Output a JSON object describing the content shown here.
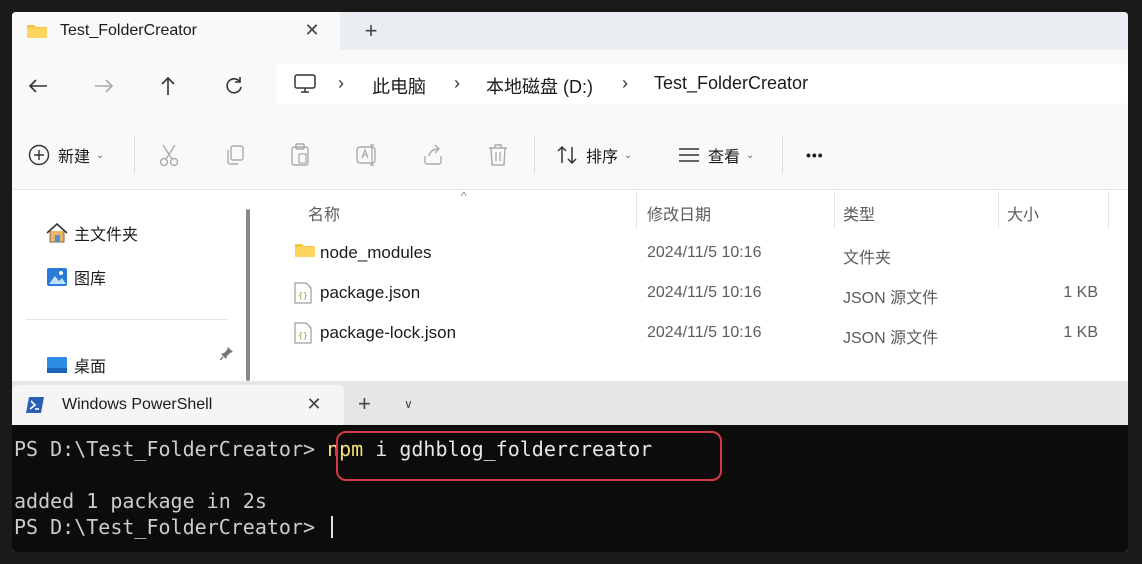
{
  "explorer": {
    "tab": {
      "title": "Test_FolderCreator",
      "close": "✕",
      "new_tab": "+"
    },
    "address": {
      "crumbs": [
        "此电脑",
        "本地磁盘 (D:)",
        "Test_FolderCreator"
      ],
      "separator": "›"
    },
    "toolbar": {
      "new_label": "新建",
      "sort_label": "排序",
      "view_label": "查看",
      "more": "•••",
      "caret": "⌄"
    },
    "nav": {
      "home": "主文件夹",
      "pictures": "图库",
      "desktop": "桌面"
    },
    "columns": {
      "name": "名称",
      "date": "修改日期",
      "type": "类型",
      "size": "大小",
      "sort_indicator": "^"
    },
    "files": [
      {
        "name": "node_modules",
        "date": "2024/11/5 10:16",
        "type": "文件夹",
        "size": "",
        "kind": "folder"
      },
      {
        "name": "package.json",
        "date": "2024/11/5 10:16",
        "type": "JSON 源文件",
        "size": "1 KB",
        "kind": "json"
      },
      {
        "name": "package-lock.json",
        "date": "2024/11/5 10:16",
        "type": "JSON 源文件",
        "size": "1 KB",
        "kind": "json"
      }
    ],
    "colors": {
      "folder": "#f4c542",
      "accent": "#0067c0"
    }
  },
  "terminal": {
    "tab": {
      "title": "Windows PowerShell",
      "close": "✕",
      "new_tab": "+",
      "dropdown": "∨"
    },
    "lines": {
      "prompt1": "PS D:\\Test_FolderCreator> ",
      "cmd_npm": "npm",
      "cmd_rest": " i gdhblog_foldercreator",
      "output": "added 1 package in 2s",
      "prompt2": "PS D:\\Test_FolderCreator> "
    },
    "colors": {
      "background": "#0c0c0c",
      "highlight": "#d23b47",
      "command": "#f2e27b"
    }
  }
}
